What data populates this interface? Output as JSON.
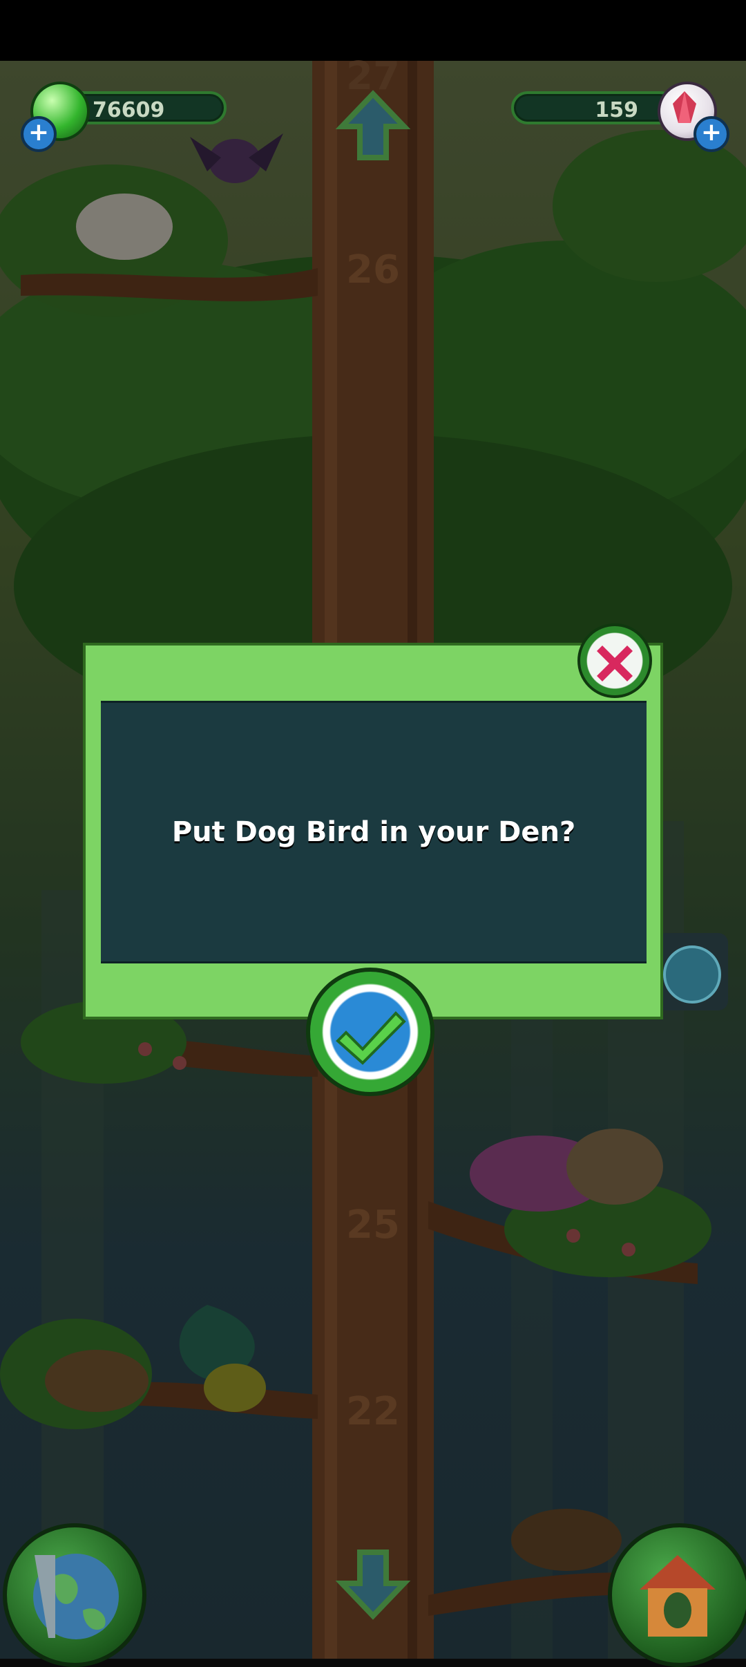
{
  "hud": {
    "coins": "76609",
    "gems": "159",
    "plus_symbol": "+"
  },
  "tree": {
    "level_markers": [
      "27",
      "26",
      "25",
      "22"
    ]
  },
  "dialog": {
    "message": "Put Dog Bird in your Den?",
    "close_icon": "close-x-icon",
    "confirm_icon": "checkmark-icon"
  },
  "controls": {
    "up_icon": "up-arrow-icon",
    "down_icon": "down-arrow-icon",
    "world_icon": "globe-icon",
    "den_icon": "den-house-icon",
    "side_den_icon": "den-icon"
  }
}
